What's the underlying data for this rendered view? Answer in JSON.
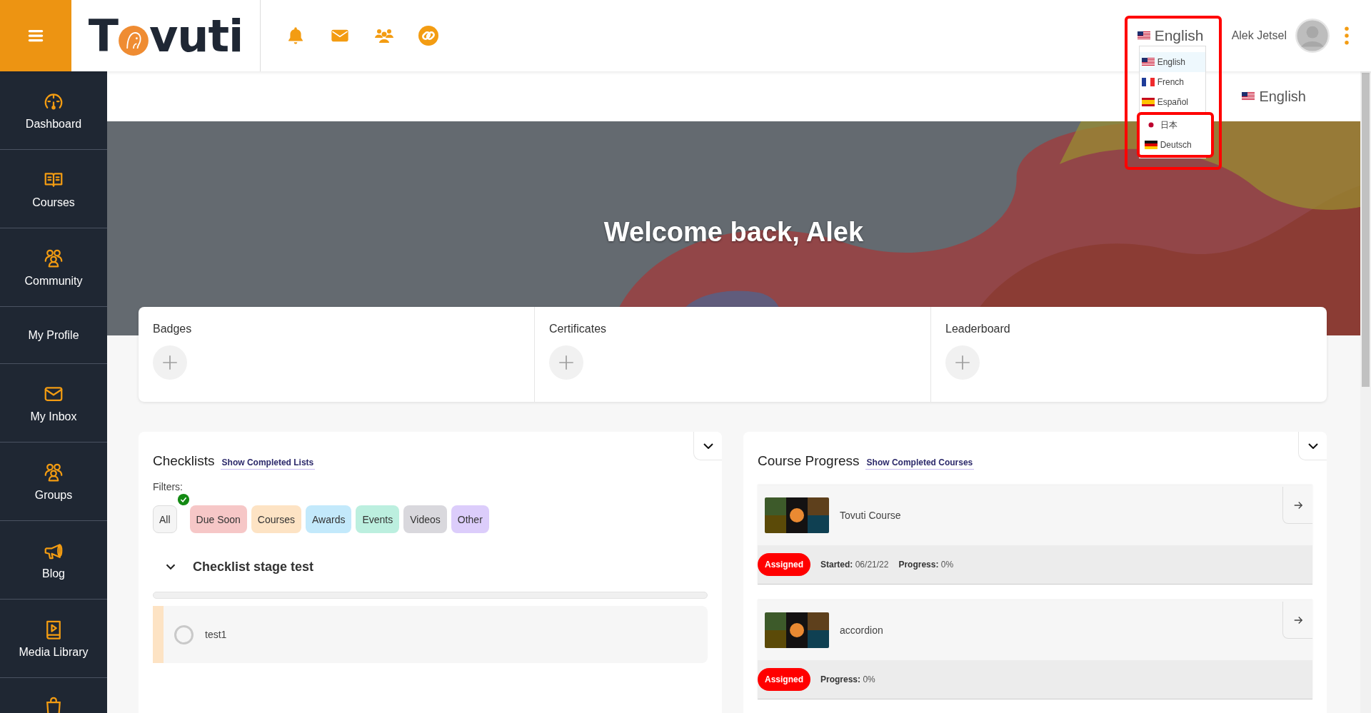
{
  "header": {
    "logo": {
      "before_mark": "T",
      "after_mark": "vuti"
    },
    "language": {
      "current": "English",
      "options": [
        {
          "label": "English",
          "selected": true
        },
        {
          "label": "French",
          "selected": false
        },
        {
          "label": "Español",
          "selected": false
        },
        {
          "label": "日本",
          "selected": false
        },
        {
          "label": "Deutsch",
          "selected": false
        }
      ]
    },
    "user_name": "Alek Jetsel"
  },
  "sidebar": {
    "items": [
      {
        "label": "Dashboard"
      },
      {
        "label": "Courses"
      },
      {
        "label": "Community"
      },
      {
        "label": "My Profile"
      },
      {
        "label": "My Inbox"
      },
      {
        "label": "Groups"
      },
      {
        "label": "Blog"
      },
      {
        "label": "Media Library"
      }
    ]
  },
  "subbar": {
    "language": "English"
  },
  "banner": {
    "title": "Welcome back, Alek"
  },
  "cards": [
    {
      "title": "Badges"
    },
    {
      "title": "Certificates"
    },
    {
      "title": "Leaderboard"
    }
  ],
  "checklists": {
    "title": "Checklists",
    "link": "Show Completed Lists",
    "filters_label": "Filters:",
    "filters": [
      {
        "label": "All",
        "selected": true,
        "color": "#f5f5f5"
      },
      {
        "label": "Due Soon",
        "selected": false,
        "color": "#f6c7c7"
      },
      {
        "label": "Courses",
        "selected": false,
        "color": "#fde3c4"
      },
      {
        "label": "Awards",
        "selected": false,
        "color": "#c3e9fb"
      },
      {
        "label": "Events",
        "selected": false,
        "color": "#bcefdf"
      },
      {
        "label": "Videos",
        "selected": false,
        "color": "#d9d8dd"
      },
      {
        "label": "Other",
        "selected": false,
        "color": "#dccdfb"
      }
    ],
    "groups": [
      {
        "title": "Checklist stage test",
        "expanded": true,
        "level": 0,
        "items": [
          {
            "label": "test1",
            "checked": false
          }
        ]
      }
    ]
  },
  "course_progress": {
    "title": "Course Progress",
    "link": "Show Completed Courses",
    "courses": [
      {
        "title": "Tovuti Course",
        "status": "Assigned",
        "started_label": "Started:",
        "started": "06/21/22",
        "progress_label": "Progress:",
        "progress": "0%"
      },
      {
        "title": "accordion",
        "status": "Assigned",
        "progress_label": "Progress:",
        "progress": "0%"
      }
    ]
  }
}
